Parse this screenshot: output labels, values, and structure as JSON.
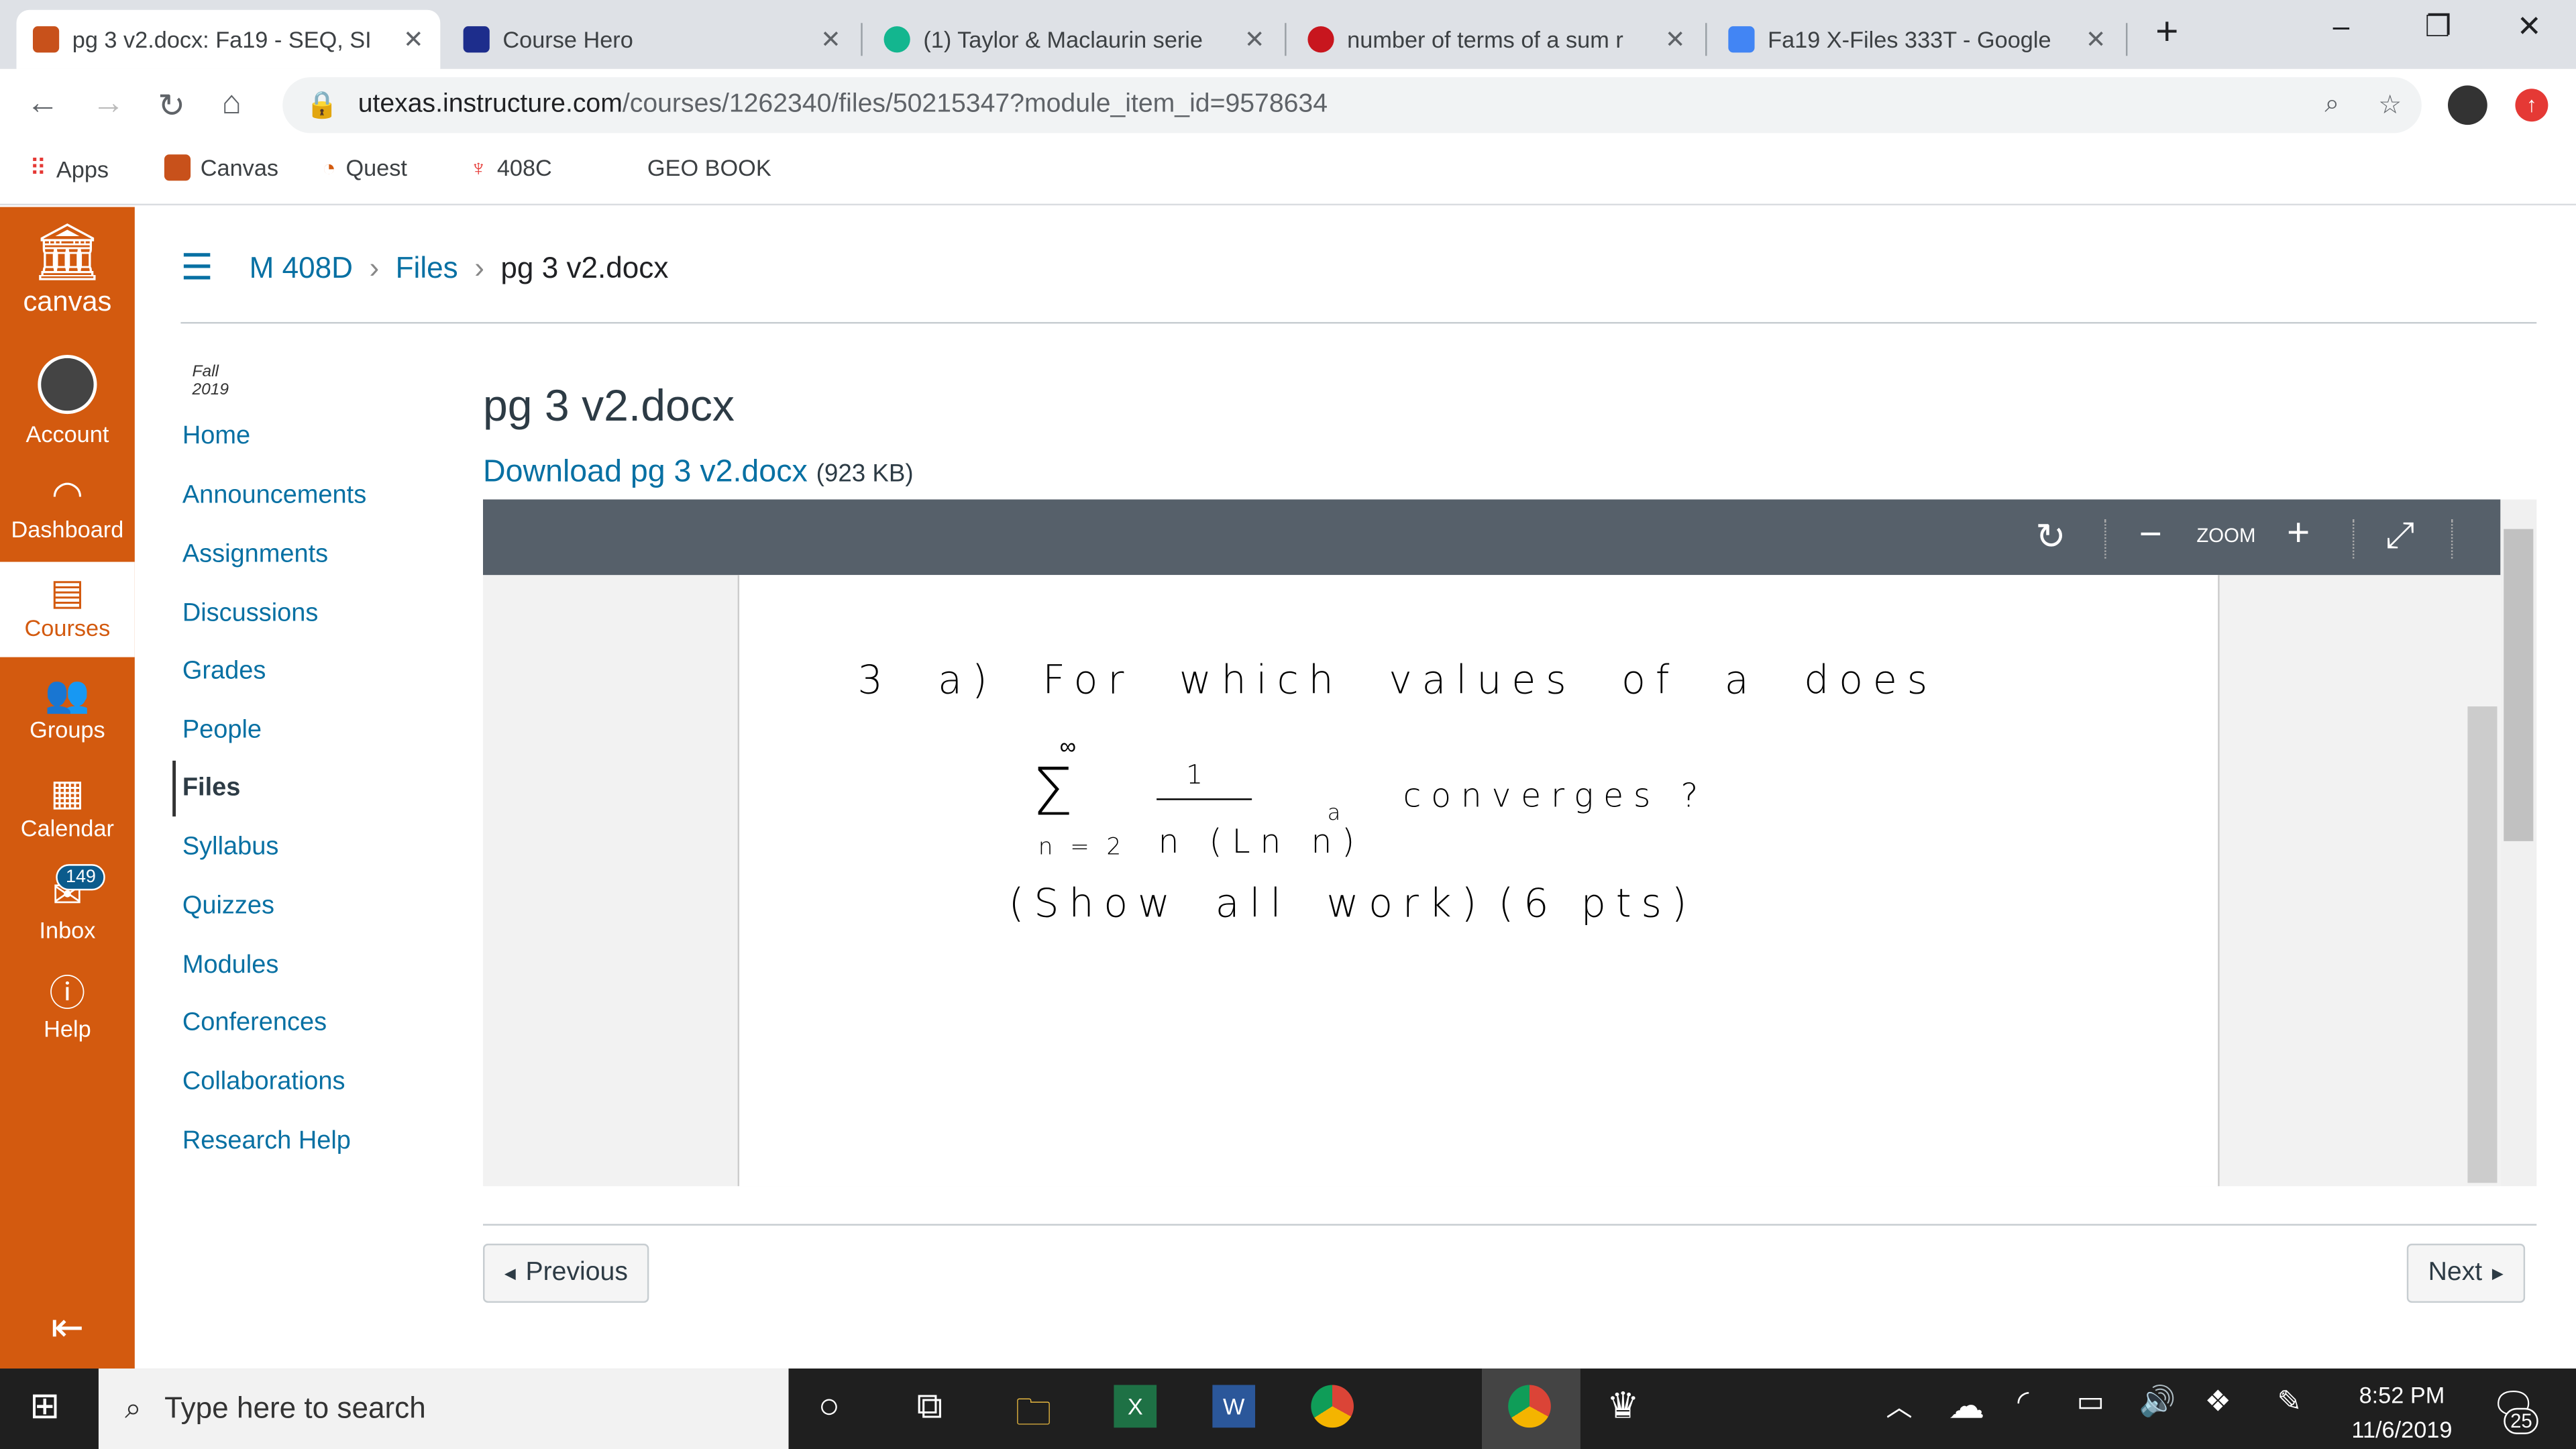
{
  "browser": {
    "tabs": [
      {
        "title": "pg 3 v2.docx: Fa19 - SEQ, SI",
        "active": true,
        "color": "#c8511b"
      },
      {
        "title": "Course Hero",
        "color": "#1d2d8c"
      },
      {
        "title": "(1) Taylor & Maclaurin serie",
        "color": "#13b68f"
      },
      {
        "title": "number of terms of a sum r",
        "color": "#c8161e"
      },
      {
        "title": "Fa19 X-Files 333T - Google",
        "color": "#4285f4"
      }
    ],
    "url_host": "utexas.instructure.com",
    "url_path": "/courses/1262340/files/50215347?module_item_id=9578634",
    "bookmarks": [
      "Apps",
      "Canvas",
      "Quest",
      "408C",
      "GEO BOOK"
    ]
  },
  "global_nav": {
    "logo": "canvas",
    "items": [
      {
        "label": "Account"
      },
      {
        "label": "Dashboard"
      },
      {
        "label": "Courses"
      },
      {
        "label": "Groups"
      },
      {
        "label": "Calendar"
      },
      {
        "label": "Inbox",
        "badge": "149"
      },
      {
        "label": "Help"
      }
    ]
  },
  "breadcrumb": [
    "M 408D",
    "Files",
    "pg 3 v2.docx"
  ],
  "course_nav": {
    "term": "Fall 2019",
    "items": [
      "Home",
      "Announcements",
      "Assignments",
      "Discussions",
      "Grades",
      "People",
      "Files",
      "Syllabus",
      "Quizzes",
      "Modules",
      "Conferences",
      "Collaborations",
      "Research Help"
    ],
    "active": "Files"
  },
  "file": {
    "title": "pg 3 v2.docx",
    "download_label": "Download pg 3 v2.docx",
    "size": "(923 KB)"
  },
  "viewer": {
    "zoom_label": "ZOOM"
  },
  "document": {
    "line1": "3 a)  For which values of a does",
    "sum_top": "∞",
    "sum": "Σ",
    "numerator": "1",
    "denominator": "n (Ln n)",
    "exponent": "a",
    "sum_bottom": "n = 2",
    "converges": "converges ?",
    "line3a": "(Show all work)",
    "line3b": "(6 pts)"
  },
  "pager": {
    "previous": "Previous",
    "next": "Next"
  },
  "taskbar": {
    "search_placeholder": "Type here to search",
    "time": "8:52 PM",
    "date": "11/6/2019",
    "notifications": "25"
  }
}
